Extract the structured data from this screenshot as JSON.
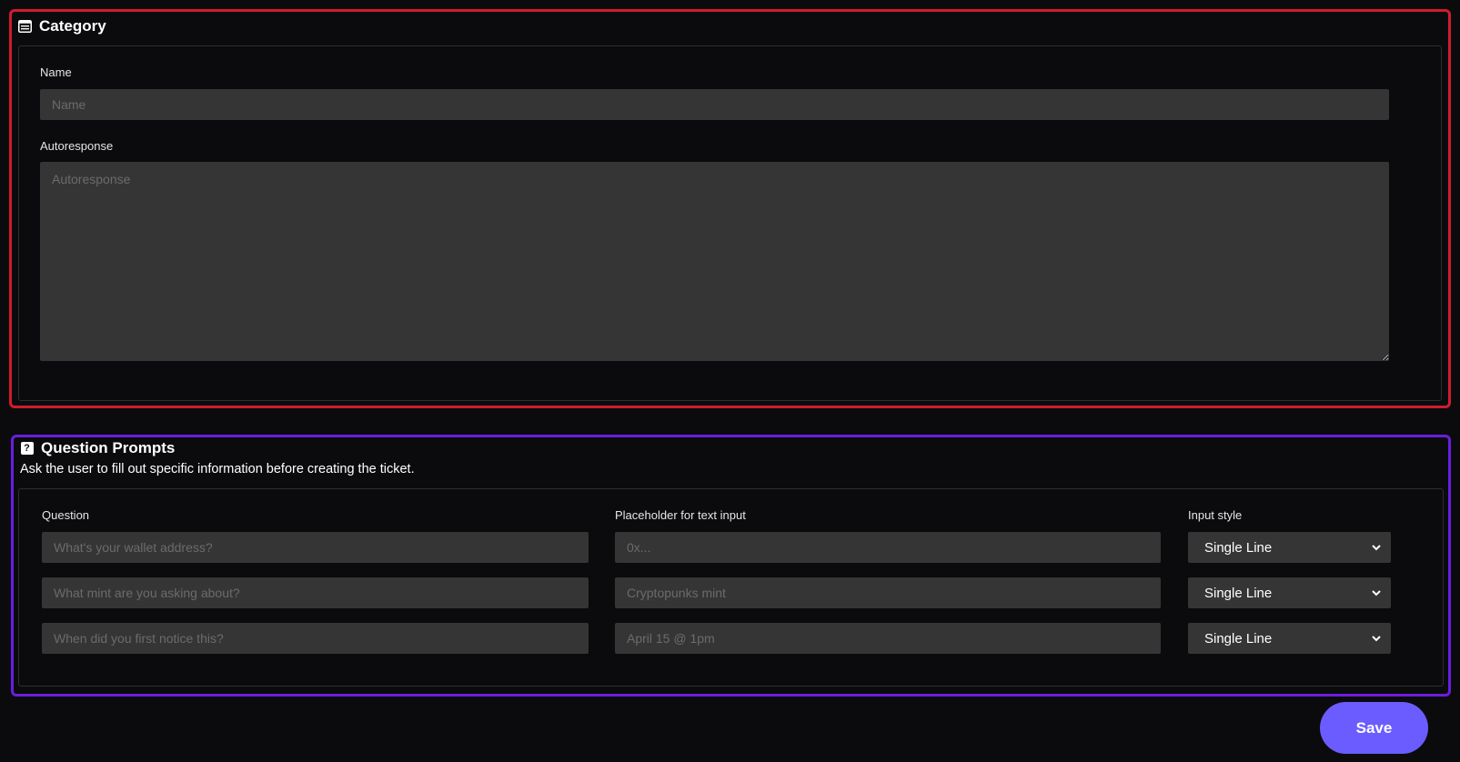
{
  "category": {
    "title": "Category",
    "icon": "list-card-icon",
    "name_label": "Name",
    "name_placeholder": "Name",
    "name_value": "",
    "autoresponse_label": "Autoresponse",
    "autoresponse_placeholder": "Autoresponse",
    "autoresponse_value": ""
  },
  "question_prompts": {
    "title": "Question Prompts",
    "icon": "question-icon",
    "description": "Ask the user to fill out specific information before creating the ticket.",
    "columns": {
      "question": "Question",
      "placeholder": "Placeholder for text input",
      "input_style": "Input style"
    },
    "rows": [
      {
        "question_placeholder": "What's your wallet address?",
        "text_placeholder": "0x...",
        "input_style": "Single Line"
      },
      {
        "question_placeholder": "What mint are you asking about?",
        "text_placeholder": "Cryptopunks mint",
        "input_style": "Single Line"
      },
      {
        "question_placeholder": "When did you first notice this?",
        "text_placeholder": "April 15 @ 1pm",
        "input_style": "Single Line"
      }
    ]
  },
  "save_button": {
    "label": "Save"
  },
  "colors": {
    "background": "#0b0b0d",
    "category_border": "#d01c2e",
    "question_prompts_border": "#6a1de0",
    "input_background": "#353535",
    "save_button": "#6b5cff"
  }
}
